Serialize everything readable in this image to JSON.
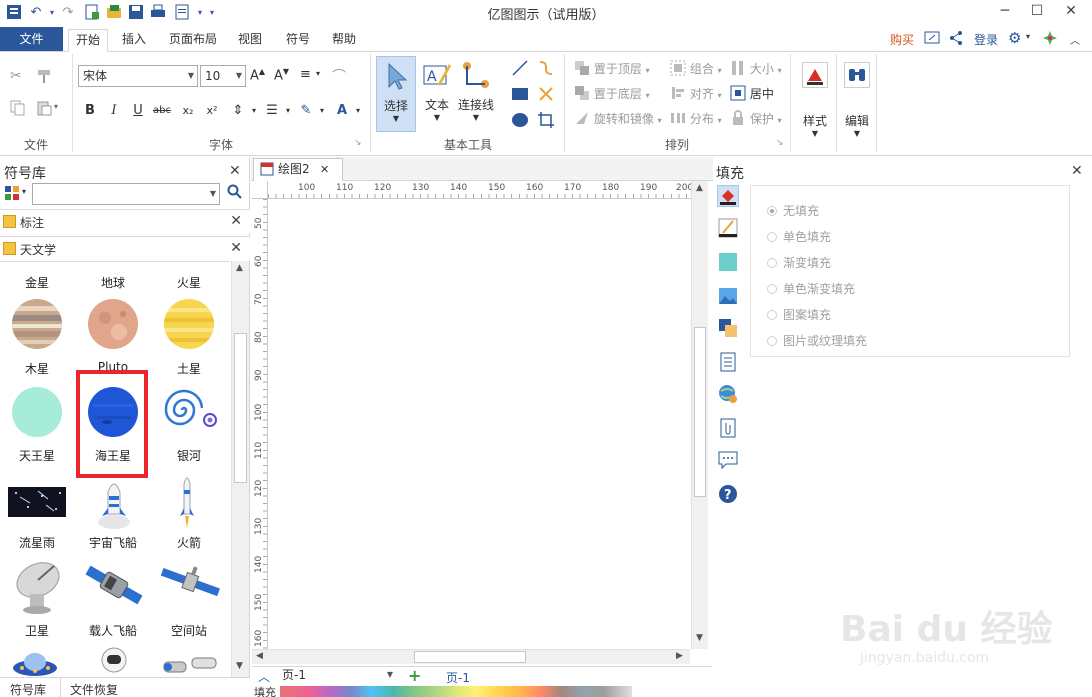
{
  "titlebar": {
    "title": "亿图图示（试用版）",
    "min": "─",
    "max": "☐",
    "close": "✕"
  },
  "menubar": {
    "file": "文件",
    "tabs": [
      "开始",
      "插入",
      "页面布局",
      "视图",
      "符号",
      "帮助"
    ],
    "buy": "购买",
    "login": "登录",
    "buy_color": "#d9531e",
    "login_color": "#2b579a"
  },
  "ribbon": {
    "groups": {
      "file": "文件",
      "font": "字体",
      "basic_tools": "基本工具",
      "arrange": "排列"
    },
    "font_name": "宋体",
    "font_size": "10",
    "select": "选择",
    "text": "文本",
    "connector": "连接线",
    "bring_front": "置于顶层",
    "send_back": "置于底层",
    "rotate_mirror": "旋转和镜像",
    "group": "组合",
    "align": "对齐",
    "distribute": "分布",
    "size": "大小",
    "center": "居中",
    "protect": "保护",
    "style": "样式",
    "edit": "编辑"
  },
  "leftpanel": {
    "title": "符号库",
    "libraries": [
      "标注",
      "天文学"
    ],
    "symbols": [
      {
        "label": "金星",
        "row": 0,
        "col": 0
      },
      {
        "label": "地球",
        "row": 0,
        "col": 1
      },
      {
        "label": "火星",
        "row": 0,
        "col": 2
      },
      {
        "label": "木星",
        "row": 1,
        "col": 0
      },
      {
        "label": "Pluto",
        "row": 1,
        "col": 1
      },
      {
        "label": "土星",
        "row": 1,
        "col": 2
      },
      {
        "label": "天王星",
        "row": 2,
        "col": 0
      },
      {
        "label": "海王星",
        "row": 2,
        "col": 1
      },
      {
        "label": "银河",
        "row": 2,
        "col": 2
      },
      {
        "label": "流星雨",
        "row": 3,
        "col": 0
      },
      {
        "label": "宇宙飞船",
        "row": 3,
        "col": 1
      },
      {
        "label": "火箭",
        "row": 3,
        "col": 2
      },
      {
        "label": "卫星",
        "row": 4,
        "col": 0
      },
      {
        "label": "载人飞船",
        "row": 4,
        "col": 1
      },
      {
        "label": "空间站",
        "row": 4,
        "col": 2
      }
    ],
    "highlight_color": "#e8262b",
    "bottom_tabs": [
      "符号库",
      "文件恢复"
    ]
  },
  "canvas": {
    "doc_tab": "绘图2",
    "hruler_ticks": [
      "100",
      "110",
      "120",
      "130",
      "140",
      "150",
      "160",
      "170",
      "180",
      "190",
      "200"
    ],
    "vruler_ticks": [
      "50",
      "60",
      "70",
      "80",
      "90",
      "100",
      "110",
      "120",
      "130",
      "140",
      "150",
      "160"
    ],
    "page_selector": "页-1",
    "page_tab": "页-1",
    "fill_label": "填充"
  },
  "fillpanel": {
    "title": "填充",
    "options": [
      "无填充",
      "单色填充",
      "渐变填充",
      "单色渐变填充",
      "图案填充",
      "图片或纹理填充"
    ],
    "selected": 0
  },
  "watermark": {
    "text": "Bai du 经验",
    "url_text": "jingyan.baidu.com"
  }
}
